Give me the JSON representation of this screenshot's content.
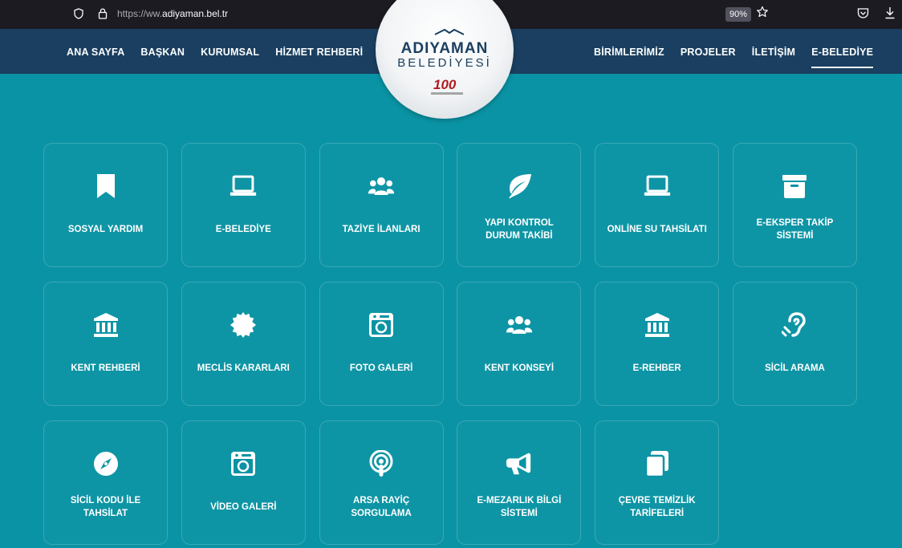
{
  "browser": {
    "url_prefix": "https://ww.",
    "url_host": "adiyaman.bel.tr",
    "zoom": "90%"
  },
  "header": {
    "nav_left": [
      "ANA SAYFA",
      "BAŞKAN",
      "KURUMSAL",
      "HİZMET REHBERİ"
    ],
    "nav_right": [
      "BİRİMLERİMİZ",
      "PROJELER",
      "İLETİŞİM",
      "E-BELEDİYE"
    ],
    "active": "E-BELEDİYE",
    "logo_title": "ADIYAMAN",
    "logo_subtitle": "BELEDİYESİ",
    "logo_badge": "100"
  },
  "colors": {
    "background": "#0a93a4",
    "header": "#1a3f60",
    "badge_red": "#b21b22"
  },
  "services": [
    {
      "label": "SOSYAL YARDIM",
      "icon": "bookmark-icon"
    },
    {
      "label": "E-BELEDİYE",
      "icon": "laptop-icon"
    },
    {
      "label": "TAZİYE İLANLARI",
      "icon": "users-icon"
    },
    {
      "label": "YAPI KONTROL\nDURUM TAKİBİ",
      "icon": "leaf-icon"
    },
    {
      "label": "ONLİNE SU TAHSİLATI",
      "icon": "laptop-icon"
    },
    {
      "label": "E-EKSPER TAKİP\nSİSTEMİ",
      "icon": "archive-icon"
    },
    {
      "label": "KENT REHBERİ",
      "icon": "bank-icon"
    },
    {
      "label": "MECLİS KARARLARI",
      "icon": "certificate-icon"
    },
    {
      "label": "FOTO GALERİ",
      "icon": "camera-icon"
    },
    {
      "label": "KENT KONSEYİ",
      "icon": "users-icon"
    },
    {
      "label": "E-REHBER",
      "icon": "bank-icon"
    },
    {
      "label": "SİCİL ARAMA",
      "icon": "hearing-icon"
    },
    {
      "label": "SİCİL KODU İLE\nTAHSİLAT",
      "icon": "compass-icon"
    },
    {
      "label": "VİDEO GALERİ",
      "icon": "camera-icon"
    },
    {
      "label": "ARSA RAYİÇ\nSORGULAMA",
      "icon": "podcast-icon"
    },
    {
      "label": "E-MEZARLIK BİLGİ\nSİSTEMİ",
      "icon": "megaphone-icon"
    },
    {
      "label": "ÇEVRE TEMİZLİK\nTARİFELERİ",
      "icon": "copy-icon"
    }
  ]
}
